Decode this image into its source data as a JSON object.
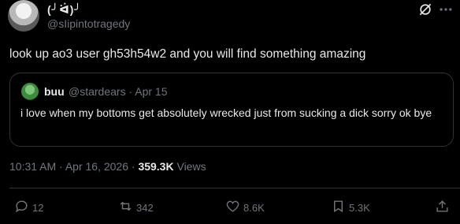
{
  "author": {
    "display_name": "(╯ᐛ)╯",
    "handle": "@sIipintotragedy"
  },
  "tweet": {
    "text": "look up ao3 user gh53h54w2 and you will find something amazing"
  },
  "quote": {
    "display_name": "buu",
    "handle": "@stardears · Apr 15",
    "text": "i love when my bottoms get absolutely wrecked just from sucking a dick sorry ok bye"
  },
  "meta": {
    "time": "10:31 AM · Apr 16, 2026 · ",
    "views_count": "359.3K",
    "views_label": " Views"
  },
  "actions": {
    "replies": "12",
    "reposts": "342",
    "likes": "8.6K",
    "bookmarks": "5.3K"
  },
  "icons": {
    "reply": "reply-icon",
    "repost": "repost-icon",
    "like": "heart-icon",
    "bookmark": "bookmark-icon",
    "share": "share-icon",
    "grok": "grok-icon",
    "more": "more-icon"
  },
  "colors": {
    "background": "#000000",
    "text": "#e7e9ea",
    "muted": "#71767b",
    "border": "#2f3336"
  }
}
